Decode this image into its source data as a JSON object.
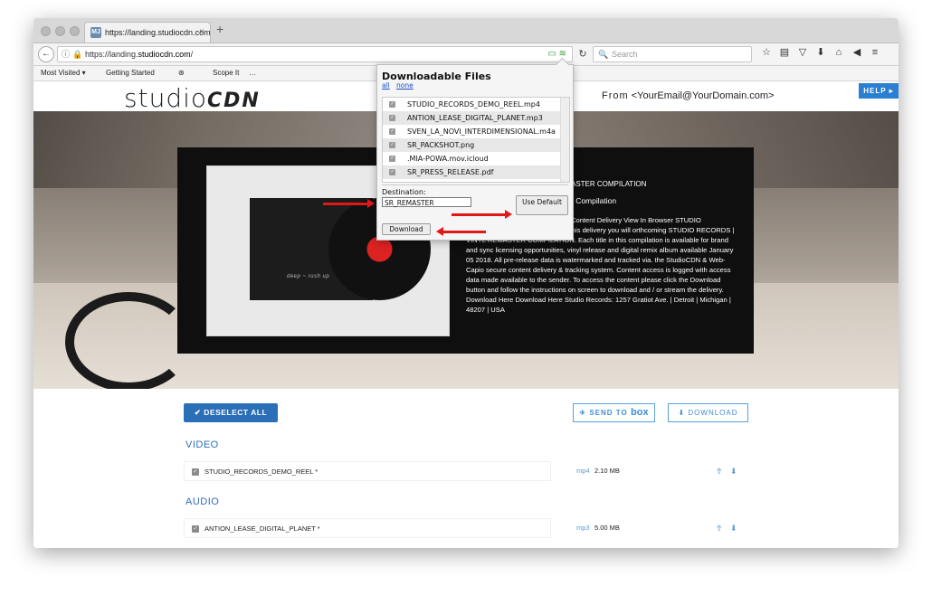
{
  "tab": {
    "favicon": "MJ",
    "title": "https://landing.studiocdn.com",
    "close": "×",
    "new_tab": "+"
  },
  "nav": {
    "back": "←",
    "info_icon": "ⓘ",
    "lock_icon": "🔒",
    "url_prefix": "https://landing.",
    "url_domain": "studiocdn.com",
    "url_suffix": "/",
    "url_right_icons": "▭ ≋",
    "reload": "↻",
    "search_icon": "🔍",
    "search_placeholder": "Search",
    "toolbar_icons": [
      "☆",
      "▤",
      "▽",
      "⬇",
      "⌂",
      "◀",
      "≡"
    ]
  },
  "bookmarks": [
    {
      "label": "Most Visited ▾"
    },
    {
      "label": "Getting Started"
    },
    {
      "label": "⊛"
    },
    {
      "label": "Scope It"
    },
    {
      "label": "…"
    }
  ],
  "site": {
    "logo_light": "studio",
    "logo_bold": "CDN",
    "from_label": "From",
    "from_email": "<YourEmail@YourDomain.com>",
    "help": "HELP ▸"
  },
  "hero": {
    "sleeve_text": "deep ~ rush up",
    "t1": "ASTER COMPILATION",
    "t2": "- Compilation",
    "t3": "Content Delivery        View In Browser STUDIO",
    "body": "                                PILATION Greetings, Enclosed in this delivery you will                                orthcoming STUDIO RECORDS | VINYL REMASTER COMPILATION. Each title in this compilation is available for brand and sync licensing opportunities, vinyl release and digital remix album available January 05 2018. All pre-release data is watermarked and tracked via. the StudioCDN & Web-Capio secure content delivery & tracking system. Content access is logged with access data made available to the sender. To access the content please click the Download button and follow the instructions on screen to download and / or stream the delivery. Download Here Download Here Studio Records: 1257 Gratiot Ave. | Detroit | Michigan | 48207 | USA"
  },
  "actions": {
    "deselect_all": "✔ DESELECT ALL",
    "send_to": "✈ SEND TO",
    "box": "box",
    "download": "⬇ DOWNLOAD"
  },
  "sections": {
    "video": "VIDEO",
    "audio": "AUDIO"
  },
  "rows": [
    {
      "name": "STUDIO_RECORDS_DEMO_REEL *",
      "ext": "mp4",
      "size": "2.10 MB"
    },
    {
      "name": "ANTION_LEASE_DIGITAL_PLANET *",
      "ext": "mp3",
      "size": "5.00 MB"
    }
  ],
  "row_icons": {
    "share": "⇮",
    "download": "⬇",
    "check": "✓"
  },
  "popup": {
    "title": "Downloadable Files",
    "all": "all",
    "none": "none",
    "files": [
      "STUDIO_RECORDS_DEMO_REEL.mp4",
      "ANTION_LEASE_DIGITAL_PLANET.mp3",
      "SVEN_LA_NOVI_INTERDIMENSIONAL.m4a",
      "SR_PACKSHOT.png",
      ".MIA-POWA.mov.icloud",
      "SR_PRESS_RELEASE.pdf"
    ],
    "destination_label": "Destination:",
    "destination_value": "SR_REMASTER",
    "use_default": "Use Default",
    "download": "Download"
  },
  "colors": {
    "accent": "#2b6fb8",
    "annotation_arrow": "#e01818"
  }
}
